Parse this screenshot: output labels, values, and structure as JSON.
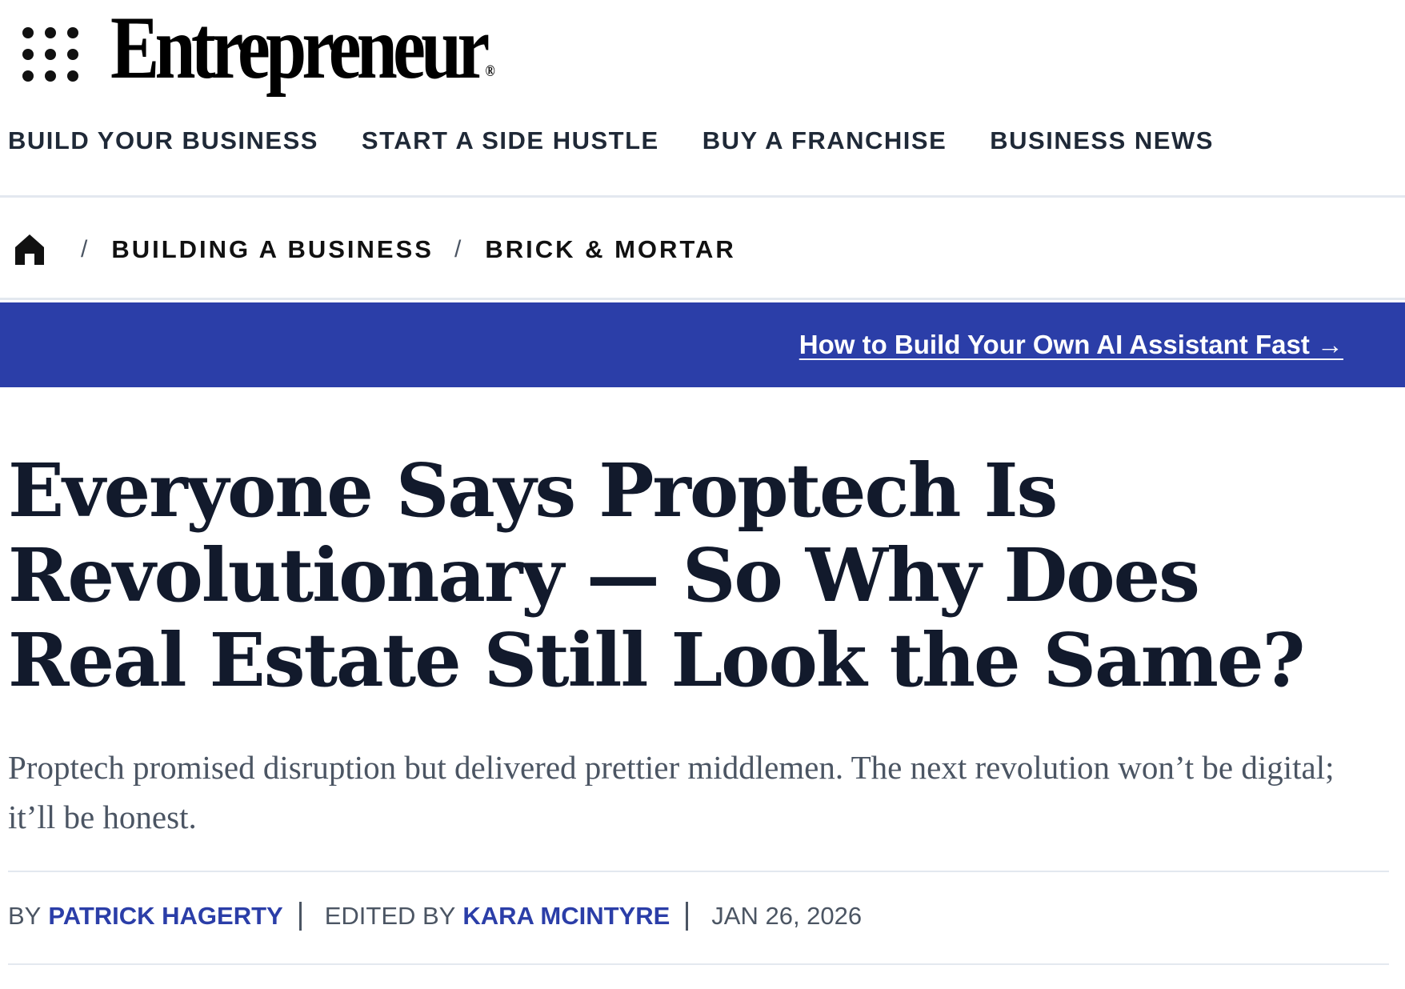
{
  "header": {
    "logo_text": "Entrepreneur",
    "logo_mark": "®",
    "menu_icon": "grid-dots-icon",
    "nav": [
      {
        "label": "BUILD YOUR BUSINESS"
      },
      {
        "label": "START A SIDE HUSTLE"
      },
      {
        "label": "BUY A FRANCHISE"
      },
      {
        "label": "BUSINESS NEWS"
      }
    ]
  },
  "breadcrumb": {
    "home_icon": "home-icon",
    "separator": "/",
    "items": [
      {
        "label": "BUILDING A BUSINESS"
      },
      {
        "label": "BRICK & MORTAR"
      }
    ]
  },
  "promo": {
    "link_text": "How to Build Your Own AI Assistant Fast →",
    "background": "#2b3ea8"
  },
  "article": {
    "headline": "Everyone Says Proptech Is Revolutionary — So Why Does Real Estate Still Look the Same?",
    "dek": "Proptech promised disruption but delivered prettier middlemen. The next revolution won’t be digital; it’ll be honest.",
    "byline": {
      "by_label": "BY",
      "author": "PATRICK HAGERTY",
      "edited_label": "EDITED BY",
      "editor": "KARA MCINTYRE",
      "date": "JAN 26, 2026"
    }
  },
  "colors": {
    "accent": "#2b3ea8",
    "headline": "#121a2c",
    "muted_text": "#4b5563",
    "rule": "#e3e8ef"
  }
}
